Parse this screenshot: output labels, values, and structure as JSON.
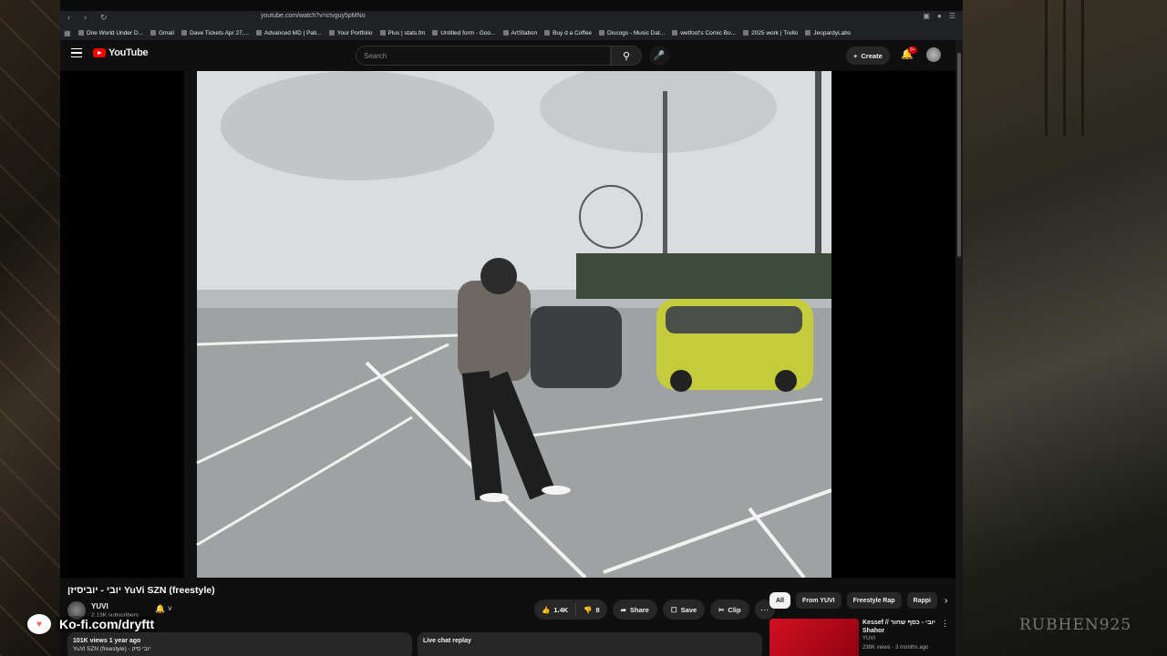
{
  "browser": {
    "url": "youtube.com/watch?v=ctvguy5pMNo",
    "bookmarks": [
      "One World Under D...",
      "Gmail",
      "Dave Tickets Apr 27,...",
      "Advanced MD | Pati...",
      "Your Portfolio",
      "Plus | stats.fm",
      "Untitled form - Goo...",
      "ArtStation",
      "Buy d a Coffee",
      "Discogs - Music Dat...",
      "wetfoot's Comic Bo...",
      "2025 work | Trello",
      "JeopardyLabs"
    ]
  },
  "header": {
    "logo_text": "YouTube",
    "search_placeholder": "Search",
    "create_label": "Create",
    "notification_count": "9+"
  },
  "video": {
    "title": "יובי - יוביסיזן YuVi SZN (freestyle)",
    "channel_name": "YUVI",
    "subscribers": "2.13K subscribers",
    "likes": "1.4K",
    "dislikes": "8",
    "share_label": "Share",
    "save_label": "Save",
    "clip_label": "Clip",
    "views_date": "101K views  1 year ago",
    "desc_snippet": "YuVi SZN (freestyle) - יובי סיזן",
    "live_chat_label": "Live chat replay"
  },
  "chips": [
    "All",
    "From YUVI",
    "Freestyle Rap",
    "Rappi"
  ],
  "recommendation": {
    "title": "Kessef // יובי - כסף שחור Shahor",
    "channel": "YUVI",
    "meta": "238K views · 3 months ago"
  },
  "overlay": {
    "kofi_text": "Ko-fi.com/dryftt",
    "watermark_text": "RUBHEN925"
  },
  "colors": {
    "accent_red": "#ff0000",
    "background": "#0f0f0f",
    "pill": "#272727"
  }
}
